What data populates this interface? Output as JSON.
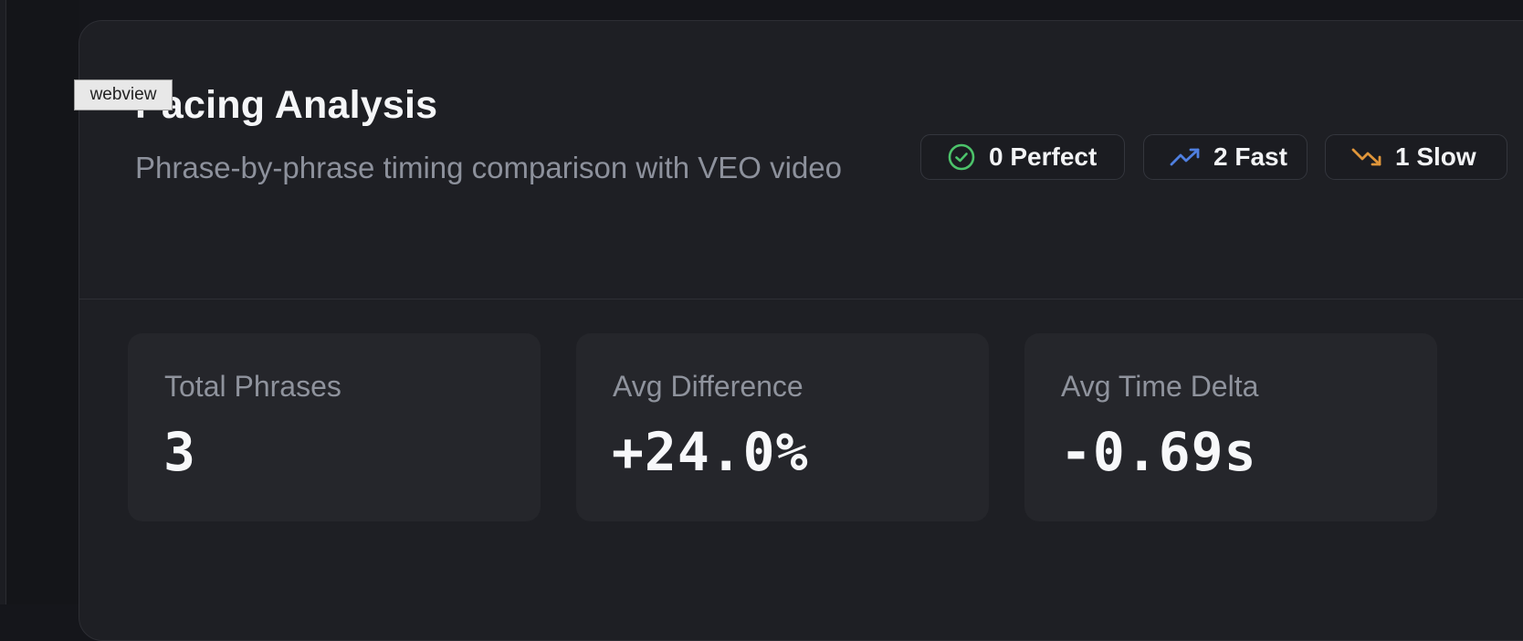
{
  "webview_tag": "webview",
  "header": {
    "title": "Pacing Analysis",
    "subtitle": "Phrase-by-phrase timing comparison with VEO video"
  },
  "badges": [
    {
      "label": "0 Perfect",
      "icon": "check-circle-icon",
      "color": "#4cc36a"
    },
    {
      "label": "2 Fast",
      "icon": "trending-up-icon",
      "color": "#4f7fe0"
    },
    {
      "label": "1 Slow",
      "icon": "trending-down-icon",
      "color": "#e0963a"
    }
  ],
  "stats": [
    {
      "label": "Total Phrases",
      "value": "3"
    },
    {
      "label": "Avg Difference",
      "value": "+24.0%"
    },
    {
      "label": "Avg Time Delta",
      "value": "-0.69s"
    }
  ]
}
